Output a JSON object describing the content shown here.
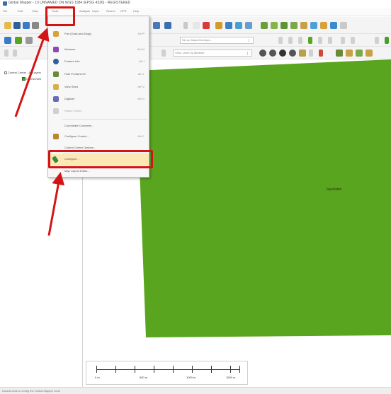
{
  "window": {
    "title": "Global Mapper - 10 UNNAMED ON WGS 1984 (EPSG 4326) - REGISTERED"
  },
  "menubar": {
    "items": [
      "File",
      "Edit",
      "View",
      "Tools",
      "Analysis",
      "Layer",
      "Search",
      "GPS",
      "Help"
    ]
  },
  "toolbar": {
    "select1": "Set up Maps/Overlays...",
    "select2": "View: Lines by Attribute"
  },
  "tree": {
    "root": "Control Center - All Layers",
    "child": "UNKNOWN"
  },
  "tools_menu": {
    "items": [
      {
        "label": "Pan (Grab-and-Drag)",
        "shortcut": "Alt+P"
      },
      {
        "label": "Measure",
        "shortcut": "Alt+M"
      },
      {
        "label": "Feature Info",
        "shortcut": "Alt+I"
      },
      {
        "label": "Path Profile/LOS",
        "shortcut": "Alt+L"
      },
      {
        "label": "View Shed",
        "shortcut": "Alt+V"
      },
      {
        "label": "Digitizer",
        "shortcut": "Alt+D"
      },
      {
        "label": "Raster Select",
        "shortcut": ""
      },
      {
        "label": "Coordinate Converter...",
        "shortcut": ""
      },
      {
        "label": "Configure Control...",
        "shortcut": "Alt+C"
      },
      {
        "label": "Control Center Options...",
        "shortcut": ""
      },
      {
        "label": "Configure...",
        "shortcut": ""
      },
      {
        "label": "Map Layout Editor...",
        "shortcut": ""
      }
    ],
    "highlighted_index": 10
  },
  "map": {
    "fill_color": "#5aa51f",
    "label": "layerlabel"
  },
  "scalebar": {
    "labels": [
      "0 m",
      "500 m",
      "1000 m",
      "1500 m"
    ]
  },
  "statusbar": {
    "text": "Double-click to config the Global Mapper tools"
  },
  "annotations": {
    "callout_color": "#d41414"
  }
}
